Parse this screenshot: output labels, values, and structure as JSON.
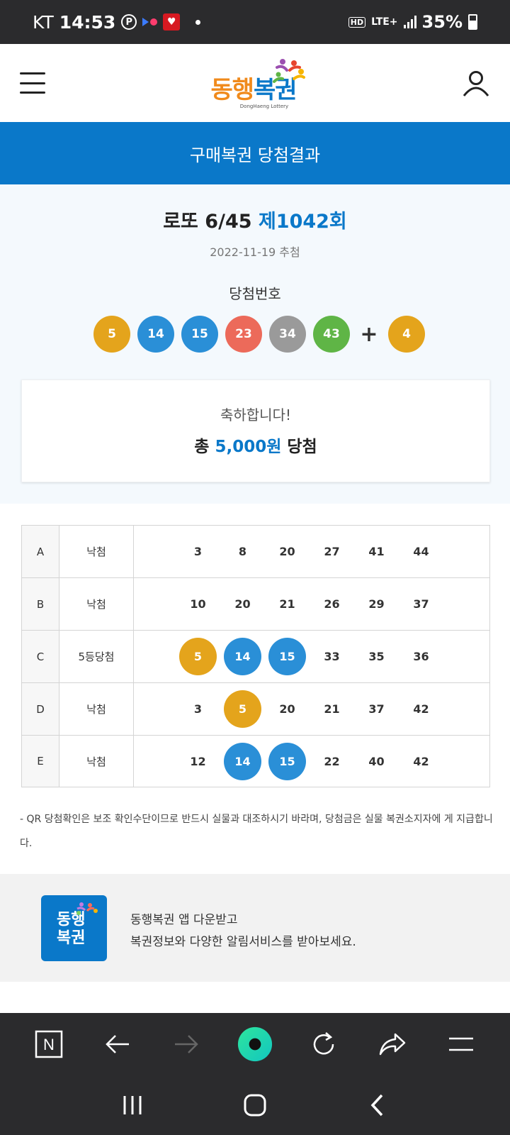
{
  "status_bar": {
    "carrier": "KT",
    "time": "14:53",
    "p_icon": "P",
    "hd": "HD",
    "network": "LTE+",
    "battery": "35%"
  },
  "header": {
    "logo_text_a": "동행",
    "logo_text_b": "복권",
    "logo_sub": "DongHaeng Lottery"
  },
  "page_title": "구매복권 당첨결과",
  "draw": {
    "game": "로또 6/45",
    "round": "제1042회",
    "date": "2022-11-19 추첨",
    "win_label": "당첨번호",
    "numbers": [
      {
        "n": "5",
        "color": "#e4a41c"
      },
      {
        "n": "14",
        "color": "#2a8fd7"
      },
      {
        "n": "15",
        "color": "#2a8fd7"
      },
      {
        "n": "23",
        "color": "#ec6a5a"
      },
      {
        "n": "34",
        "color": "#9a9a9a"
      },
      {
        "n": "43",
        "color": "#5fb546"
      }
    ],
    "plus": "+",
    "bonus": {
      "n": "4",
      "color": "#e4a41c"
    }
  },
  "prize": {
    "congrats": "축하합니다!",
    "total_prefix": "총",
    "total_amount": "5,000원",
    "total_suffix": "당첨"
  },
  "ticket": [
    {
      "letter": "A",
      "result": "낙첨",
      "nums": [
        {
          "n": "3"
        },
        {
          "n": "8"
        },
        {
          "n": "20"
        },
        {
          "n": "27"
        },
        {
          "n": "41"
        },
        {
          "n": "44"
        }
      ]
    },
    {
      "letter": "B",
      "result": "낙첨",
      "nums": [
        {
          "n": "10"
        },
        {
          "n": "20"
        },
        {
          "n": "21"
        },
        {
          "n": "26"
        },
        {
          "n": "29"
        },
        {
          "n": "37"
        }
      ]
    },
    {
      "letter": "C",
      "result": "5등당첨",
      "nums": [
        {
          "n": "5",
          "hit": "#e4a41c"
        },
        {
          "n": "14",
          "hit": "#2a8fd7"
        },
        {
          "n": "15",
          "hit": "#2a8fd7"
        },
        {
          "n": "33"
        },
        {
          "n": "35"
        },
        {
          "n": "36"
        }
      ]
    },
    {
      "letter": "D",
      "result": "낙첨",
      "nums": [
        {
          "n": "3"
        },
        {
          "n": "5",
          "hit": "#e4a41c"
        },
        {
          "n": "20"
        },
        {
          "n": "21"
        },
        {
          "n": "37"
        },
        {
          "n": "42"
        }
      ]
    },
    {
      "letter": "E",
      "result": "낙첨",
      "nums": [
        {
          "n": "12"
        },
        {
          "n": "14",
          "hit": "#2a8fd7"
        },
        {
          "n": "15",
          "hit": "#2a8fd7"
        },
        {
          "n": "22"
        },
        {
          "n": "40"
        },
        {
          "n": "42"
        }
      ]
    }
  ],
  "notice": "- QR 당첨확인은 보조 확인수단이므로 반드시 실물과 대조하시기 바라며, 당첨금은 실물 복권소지자에 게 지급합니다.",
  "promo": {
    "logo_line1": "동행",
    "logo_line2": "복권",
    "line1": "동행복권 앱 다운받고",
    "line2": "복권정보와 다양한 알림서비스를 받아보세요."
  },
  "browser": {
    "n_icon": "N",
    "icons": [
      "n-home-icon",
      "back-arrow-icon",
      "forward-arrow-icon",
      "green-dot-icon",
      "refresh-icon",
      "share-icon",
      "menu-icon"
    ]
  },
  "colors": {
    "brand_blue": "#0a78c9",
    "ball_yellow": "#e4a41c",
    "ball_blue": "#2a8fd7",
    "ball_red": "#ec6a5a",
    "ball_gray": "#9a9a9a",
    "ball_green": "#5fb546"
  }
}
